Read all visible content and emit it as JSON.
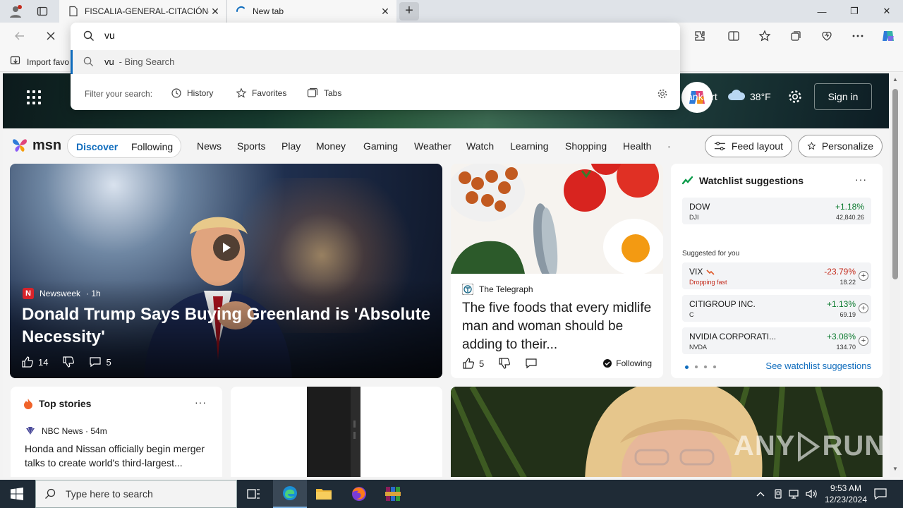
{
  "browser": {
    "tabs": [
      {
        "title": "FISCALIA-GENERAL-CITACIÓN-P",
        "close": "✕"
      },
      {
        "title": "New tab",
        "close": "✕"
      }
    ],
    "new_tab": "+",
    "window_controls": {
      "minimize": "—",
      "maximize": "❐",
      "close": "✕"
    },
    "favorites_bar": {
      "import_label": "Import favo"
    }
  },
  "omnibox": {
    "value": "vu",
    "suggestion": {
      "query": "vu",
      "suffix": " - Bing Search"
    },
    "filter": {
      "label": "Filter your search:",
      "options": [
        "History",
        "Favorites",
        "Tabs"
      ]
    }
  },
  "msn": {
    "brand": "msn",
    "header": {
      "city": "ankfurt",
      "temperature": "38°F",
      "signin": "Sign in"
    },
    "pill_tabs": [
      "Discover",
      "Following"
    ],
    "nav": [
      "News",
      "Sports",
      "Play",
      "Money",
      "Gaming",
      "Weather",
      "Watch",
      "Learning",
      "Shopping",
      "Health"
    ],
    "nav_trailing": "·",
    "actions": {
      "feed_layout": "Feed layout",
      "personalize": "Personalize"
    },
    "hero": {
      "source": "Newsweek",
      "source_badge": "N",
      "age": "· 1h",
      "title": "Donald Trump Says Buying Greenland is 'Absolute Necessity'",
      "likes": "14",
      "comments": "5"
    },
    "telegraph": {
      "source": "The Telegraph",
      "title": "The five foods that every midlife man and woman should be adding to their...",
      "likes": "5",
      "following": "Following"
    },
    "watchlist": {
      "title": "Watchlist suggestions",
      "more": "···",
      "suggested_label": "Suggested for you",
      "see_more": "See watchlist suggestions",
      "stocks": [
        {
          "name": "DOW",
          "symbol": "DJI",
          "change": "+1.18%",
          "price": "42,840.26",
          "note": "",
          "direction": "up"
        },
        {
          "name": "VIX",
          "symbol": "",
          "change": "-23.79%",
          "price": "18.22",
          "note": "Dropping fast",
          "direction": "down"
        },
        {
          "name": "CITIGROUP INC.",
          "symbol": "C",
          "change": "+1.13%",
          "price": "69.19",
          "note": "",
          "direction": "up"
        },
        {
          "name": "NVIDIA CORPORATI...",
          "symbol": "NVDA",
          "change": "+3.08%",
          "price": "134.70",
          "note": "",
          "direction": "up"
        }
      ],
      "add": "+"
    },
    "top_stories": {
      "title": "Top stories",
      "more": "···",
      "source": "NBC News · 54m",
      "headline": "Honda and Nissan officially begin merger talks to create world's third-largest..."
    }
  },
  "watermark": {
    "left": "ANY",
    "right": "RUN"
  },
  "taskbar": {
    "search_placeholder": "Type here to search",
    "time": "9:53 AM",
    "date": "12/23/2024"
  },
  "colors": {
    "accent": "#0f6cbd",
    "positive": "#0b7a2e",
    "negative": "#c42b1c",
    "taskbar": "#1f2b36"
  }
}
